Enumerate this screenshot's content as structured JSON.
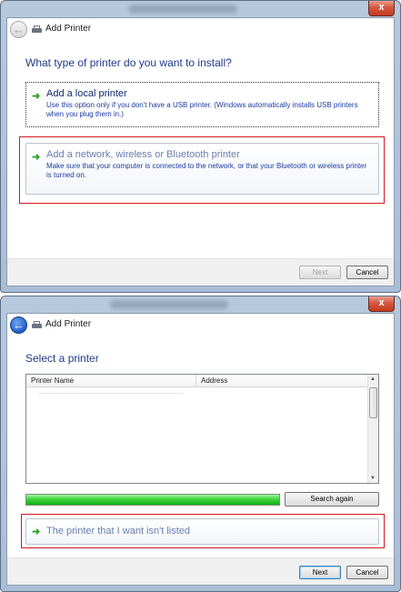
{
  "screen1": {
    "nav_title": "Add Printer",
    "heading": "What type of printer do you want to install?",
    "options": [
      {
        "title": "Add a local printer",
        "description": "Use this option only if you don't have a USB printer. (Windows automatically installs USB printers when you plug them in.)"
      },
      {
        "title": "Add a network, wireless or Bluetooth printer",
        "description": "Make sure that your computer is connected to the network, or that your Bluetooth or wireless printer is turned on."
      }
    ],
    "buttons": {
      "next": "Next",
      "cancel": "Cancel"
    }
  },
  "screen2": {
    "nav_title": "Add Printer",
    "heading": "Select a printer",
    "list_columns": [
      "Printer Name",
      "Address"
    ],
    "search_progress": 1.0,
    "search_again": "Search again",
    "not_listed": "The printer that I want isn't listed",
    "buttons": {
      "next": "Next",
      "cancel": "Cancel"
    }
  },
  "close_glyph": "x",
  "icons": [
    "back-arrow-icon",
    "printer-icon",
    "green-arrow-icon",
    "close-icon"
  ],
  "colors": {
    "heading": "#1e3a8a",
    "highlight_border": "#d01920",
    "progress": "#22c322"
  }
}
